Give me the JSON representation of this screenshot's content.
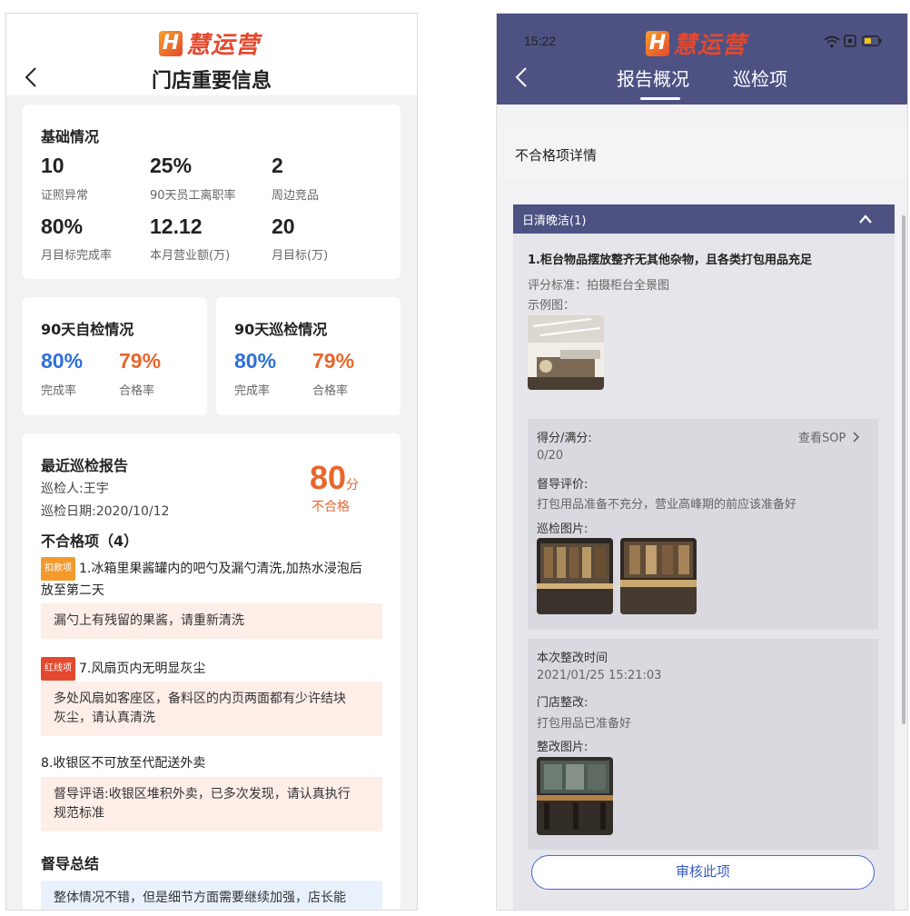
{
  "brand": {
    "logo_letter": "H",
    "logo_text": "慧运营"
  },
  "left": {
    "title": "门店重要信息",
    "basic": {
      "title": "基础情况",
      "stats": [
        {
          "value": "10",
          "label": "证照异常",
          "color": "#e8662c"
        },
        {
          "value": "25%",
          "label": "90天员工离职率",
          "color": "#222222"
        },
        {
          "value": "2",
          "label": "周边竞品",
          "color": "#222222"
        },
        {
          "value": "80%",
          "label": "月目标完成率",
          "color": "#222222"
        },
        {
          "value": "12.12",
          "label": "本月营业额(万)",
          "color": "#222222"
        },
        {
          "value": "20",
          "label": "月目标(万)",
          "color": "#222222"
        }
      ]
    },
    "self_check": {
      "title": "90天自检情况",
      "completion": "80%",
      "completion_label": "完成率",
      "pass": "79%",
      "pass_label": "合格率"
    },
    "patrol_check": {
      "title": "90天巡检情况",
      "completion": "80%",
      "completion_label": "完成率",
      "pass": "79%",
      "pass_label": "合格率"
    },
    "report": {
      "title": "最近巡检报告",
      "inspector": "巡检人:王宇",
      "date": "巡检日期:2020/10/12",
      "score": "80",
      "score_unit": "分",
      "result": "不合格",
      "fail_title": "不合格项（4）",
      "items": [
        {
          "tag": "扣款项",
          "line1": "1.冰箱里果酱罐内的吧勺及漏勺清洗,加热水浸泡后",
          "line2": "放至第二天",
          "fb1": "漏勺上有残留的果酱，请重新清洗",
          "fb2": ""
        },
        {
          "tag": "红线项",
          "line1": "7.风扇页内无明显灰尘",
          "line2": "",
          "fb1": "多处风扇如客座区，备料区的内页两面都有少许结块",
          "fb2": "灰尘，请认真清洗"
        },
        {
          "tag": "",
          "line1": "8.收银区不可放至代配送外卖",
          "line2": "",
          "fb1": "督导评语:收银区堆积外卖，已多次发现，请认真执行",
          "fb2": "规范标准"
        }
      ],
      "summary_title": "督导总结",
      "summary_text": "整体情况不错，但是细节方面需要继续加强，店长能"
    }
  },
  "right": {
    "status_time": "15:22",
    "tabs": [
      "报告概况",
      "巡检项"
    ],
    "section_title": "不合格项详情",
    "accordion_title": "日清晚洁(1)",
    "item_title": "1.柜台物品摆放整齐无其他杂物，且各类打包用品充足",
    "criteria": "评分标准：拍摄柜台全景图",
    "example_label": "示例图：",
    "score_label": "得分/满分:",
    "view_sop": "查看SOP",
    "score_value": "0/20",
    "eval_label": "督导评价:",
    "eval_text": "打包用品准备不充分，营业高峰期的前应该准备好",
    "patrol_photos_label": "巡检图片:",
    "rect_time_label": "本次整改时间",
    "rect_time": "2021/01/25 15:21:03",
    "store_rect_label": "门店整改:",
    "store_rect_text": "打包用品已准备好",
    "rect_photos_label": "整改图片:",
    "audit_button": "审核此项"
  },
  "colors": {
    "accent_orange": "#e8662c",
    "accent_blue": "#2e6fd8",
    "header_purple": "#4d5283"
  },
  "icons": [
    "back-chevron-icon",
    "wifi-icon",
    "sim-icon",
    "battery-icon",
    "chevron-up-icon",
    "chevron-right-icon"
  ]
}
